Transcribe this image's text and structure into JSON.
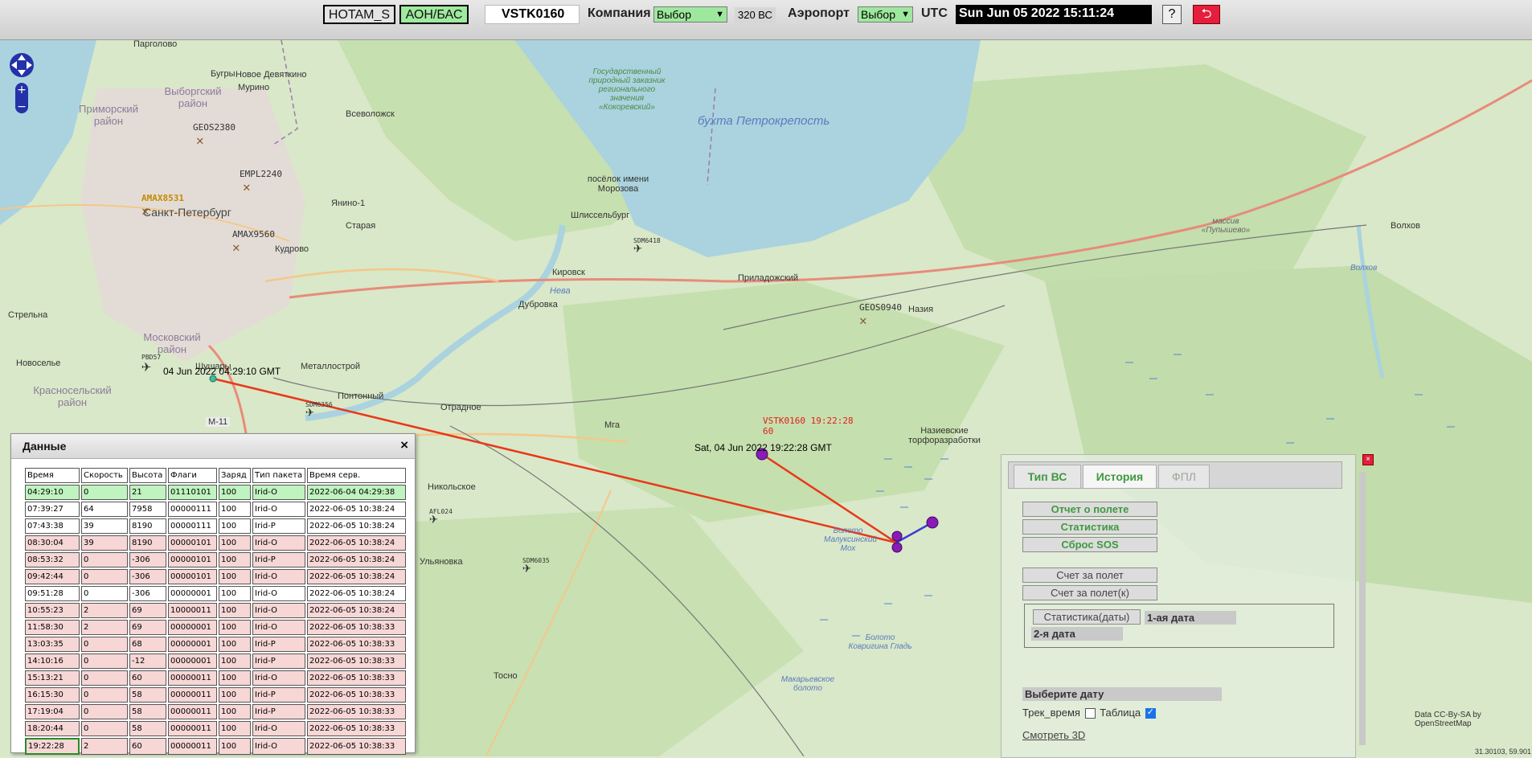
{
  "topbar": {
    "notam_label": "HOTAM_S",
    "aon_label": "АОН/БАС",
    "search_value": "VSTK0160",
    "company_label": "Компания",
    "company_select": "Выбор",
    "aircraft_count": "320 ВС",
    "airport_label": "Аэропорт",
    "airport_select": "Выбор",
    "utc_label": "UTC",
    "utc_value": "Sun Jun 05 2022 15:11:24",
    "help_label": "?",
    "exit_icon": "exit-arrow-icon"
  },
  "map": {
    "labels": {
      "pargolovo": "Парголово",
      "bugry": "Бугры",
      "vyborgsky": "Выборгский район",
      "primorsky": "Приморский район",
      "novoe_devyatkino": "Новое Девяткино",
      "murino": "Мурино",
      "vsevolozhsk": "Всеволожск",
      "spb": "Санкт-Петербург",
      "yanino": "Янино-1",
      "staraya": "Старая",
      "kudrovo": "Кудрово",
      "strelna": "Стрельна",
      "moskovsky": "Московский район",
      "novoselye": "Новоселье",
      "krasnoselsky": "Красносельский район",
      "shushary": "Шушары",
      "metallostroy": "Металлострой",
      "pontonny": "Понтонный",
      "otradnoe": "Отрадное",
      "mga": "Мга",
      "m11": "М-11",
      "nikolskoe": "Никольское",
      "ulyanovka": "Ульяновка",
      "tosno": "Тосно",
      "kirovsk": "Кировск",
      "dubrovka": "Дубровка",
      "neva": "Нева",
      "shlisselburg": "Шлиссельбург",
      "morozova": "посёлок имени Морозова",
      "reserve": "Государственный природный заказник регионального значения «Кокоревский»",
      "bay": "бухта Петрокрепость",
      "priladozhsky": "Приладожский",
      "naziya": "Назия",
      "nazievskie": "Назиевские торфоразработки",
      "maluksinsky": "Болото Малуксинский Мох",
      "kovrigina": "Болото Ковригина Гладь",
      "makarevskoe": "Макарьевское болото",
      "pushtsevo": "массив «Пупышево»",
      "volkhov": "Волхов",
      "volkhov_river": "Волхов"
    },
    "markers": {
      "geos2380": "GEOS2380",
      "empl2240": "EMPL2240",
      "amax": "AMAX8531",
      "amax9560": "AMAX9560",
      "sdm6418": "SDM6418",
      "geos0940": "GEOS0940",
      "sdm6356": "SDM6356",
      "afl024": "AFL024",
      "sdm6035": "SDM6035",
      "pbd": "PBD57"
    },
    "track_start_label": "04 Jun 2022 04:29:10 GMT",
    "track_end_label": "Sat, 04 Jun 2022 19:22:28 GMT",
    "aircraft_label_line1": "VSTK0160 19:22:28",
    "aircraft_label_line2": "60",
    "track_color": "#e8381a",
    "attribution": "Data CC-By-SA by OpenStreetMap",
    "coords": "31.30103, 59.901"
  },
  "data_panel": {
    "title": "Данные",
    "close_label": "×",
    "columns": [
      "Время",
      "Скорость",
      "Высота",
      "Флаги",
      "Заряд",
      "Тип пакета",
      "Время серв."
    ],
    "rows": [
      {
        "status": "ok",
        "cells": [
          "04:29:10",
          "0",
          "21",
          "01110101",
          "100",
          "Irid-O",
          "2022-06-04 04:29:38"
        ]
      },
      {
        "status": "plain",
        "cells": [
          "07:39:27",
          "64",
          "7958",
          "00000111",
          "100",
          "Irid-O",
          "2022-06-05 10:38:24"
        ]
      },
      {
        "status": "plain",
        "cells": [
          "07:43:38",
          "39",
          "8190",
          "00000111",
          "100",
          "Irid-P",
          "2022-06-05 10:38:24"
        ]
      },
      {
        "status": "err",
        "cells": [
          "08:30:04",
          "39",
          "8190",
          "00000101",
          "100",
          "Irid-O",
          "2022-06-05 10:38:24"
        ]
      },
      {
        "status": "err",
        "cells": [
          "08:53:32",
          "0",
          "-306",
          "00000101",
          "100",
          "Irid-P",
          "2022-06-05 10:38:24"
        ]
      },
      {
        "status": "err",
        "cells": [
          "09:42:44",
          "0",
          "-306",
          "00000101",
          "100",
          "Irid-O",
          "2022-06-05 10:38:24"
        ]
      },
      {
        "status": "plain",
        "cells": [
          "09:51:28",
          "0",
          "-306",
          "00000001",
          "100",
          "Irid-O",
          "2022-06-05 10:38:24"
        ]
      },
      {
        "status": "err",
        "cells": [
          "10:55:23",
          "2",
          "69",
          "10000011",
          "100",
          "Irid-O",
          "2022-06-05 10:38:24"
        ]
      },
      {
        "status": "err",
        "cells": [
          "11:58:30",
          "2",
          "69",
          "00000001",
          "100",
          "Irid-O",
          "2022-06-05 10:38:33"
        ]
      },
      {
        "status": "err",
        "cells": [
          "13:03:35",
          "0",
          "68",
          "00000001",
          "100",
          "Irid-P",
          "2022-06-05 10:38:33"
        ]
      },
      {
        "status": "err",
        "cells": [
          "14:10:16",
          "0",
          "-12",
          "00000001",
          "100",
          "Irid-P",
          "2022-06-05 10:38:33"
        ]
      },
      {
        "status": "err",
        "cells": [
          "15:13:21",
          "0",
          "60",
          "00000011",
          "100",
          "Irid-O",
          "2022-06-05 10:38:33"
        ]
      },
      {
        "status": "err",
        "cells": [
          "16:15:30",
          "0",
          "58",
          "00000011",
          "100",
          "Irid-P",
          "2022-06-05 10:38:33"
        ]
      },
      {
        "status": "err",
        "cells": [
          "17:19:04",
          "0",
          "58",
          "00000011",
          "100",
          "Irid-P",
          "2022-06-05 10:38:33"
        ]
      },
      {
        "status": "err",
        "cells": [
          "18:20:44",
          "0",
          "58",
          "00000011",
          "100",
          "Irid-O",
          "2022-06-05 10:38:33"
        ]
      },
      {
        "status": "err",
        "cells": [
          "19:22:28",
          "2",
          "60",
          "00000011",
          "100",
          "Irid-O",
          "2022-06-05 10:38:33"
        ]
      }
    ]
  },
  "history_panel": {
    "close_label": "×",
    "tabs": [
      "Тип ВС",
      "История",
      "ФПЛ"
    ],
    "flight_report": "Отчет о полете",
    "statistics": "Статистика",
    "reset_sos": "Сброс SOS",
    "invoice": "Счет за полет",
    "invoice_k": "Счет за полет(к)",
    "stats_dates": "Статистика(даты)",
    "date1": "1-ая дата",
    "date2": "2-я дата",
    "choose_date": "Выберите дату",
    "track_time": "Трек_время",
    "table_label": "Таблица",
    "view3d": "Смотреть 3D"
  }
}
